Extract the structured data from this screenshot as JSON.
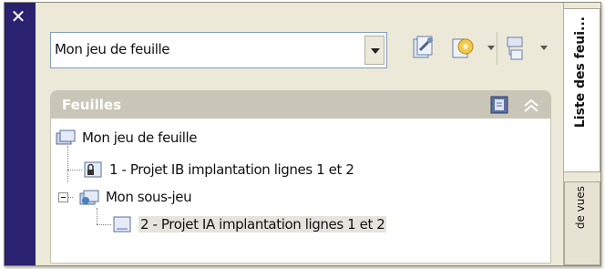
{
  "window": {
    "close_glyph": "✕",
    "accent_color": "#2a2170"
  },
  "sheet_set_selector": {
    "value": "Mon jeu de feuille"
  },
  "toolbar": {
    "buttons": [
      "sheet-set-tool-icon",
      "publish-icon",
      "view-options-icon"
    ]
  },
  "panel": {
    "title": "Feuilles"
  },
  "tree": {
    "root": "Mon jeu de feuille",
    "items": [
      {
        "label": "1 - Projet IB implantation lignes 1 et 2",
        "level": 1,
        "selected": false
      },
      {
        "label": "Mon sous-jeu",
        "level": 1,
        "expanded": true
      },
      {
        "label": "2 - Projet IA implantation lignes 1 et 2",
        "level": 2,
        "selected": true
      }
    ]
  },
  "side_tabs": {
    "active": "Liste des feui...",
    "inactive": "de vues"
  }
}
